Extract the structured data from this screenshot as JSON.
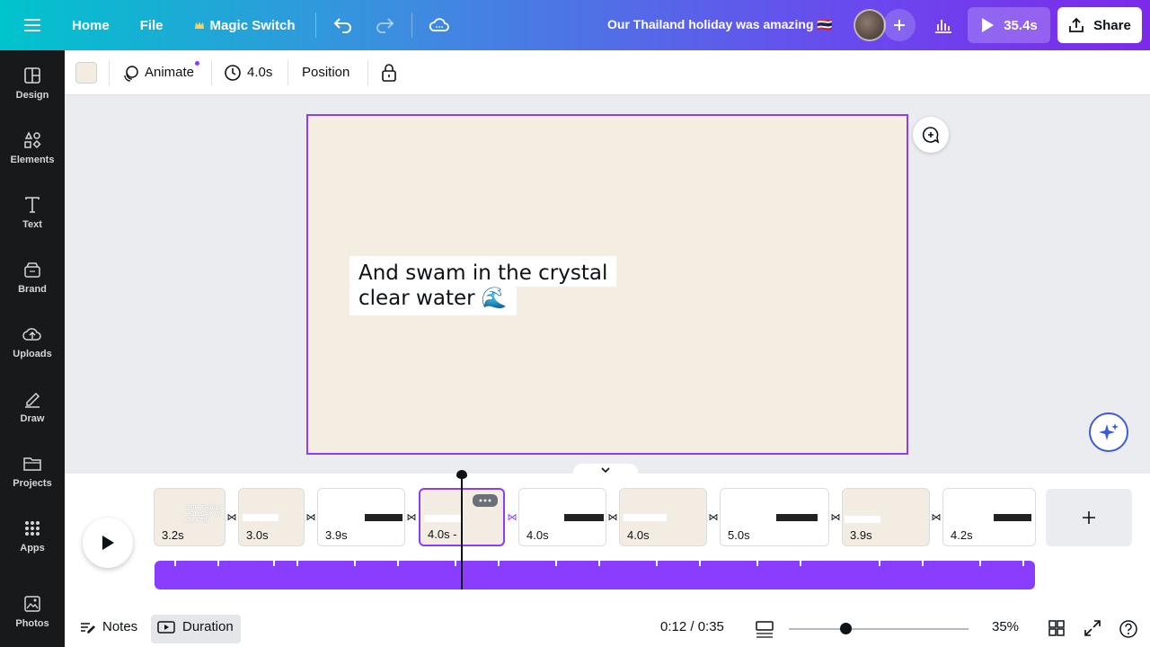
{
  "topbar": {
    "home": "Home",
    "file": "File",
    "magic_switch": "Magic Switch",
    "title": "Our Thailand holiday was amazing 🇹🇭",
    "play_duration": "35.4s",
    "share": "Share"
  },
  "sidebar": {
    "items": [
      {
        "label": "Design",
        "icon": "design-icon"
      },
      {
        "label": "Elements",
        "icon": "elements-icon"
      },
      {
        "label": "Text",
        "icon": "text-icon"
      },
      {
        "label": "Brand",
        "icon": "brand-icon"
      },
      {
        "label": "Uploads",
        "icon": "uploads-icon"
      },
      {
        "label": "Draw",
        "icon": "draw-icon"
      },
      {
        "label": "Projects",
        "icon": "projects-icon"
      },
      {
        "label": "Apps",
        "icon": "apps-icon"
      },
      {
        "label": "Photos",
        "icon": "photos-icon"
      }
    ]
  },
  "toolbar": {
    "background_color": "#f3ece1",
    "animate": "Animate",
    "duration": "4.0s",
    "position": "Position"
  },
  "canvas": {
    "background": "#f3ede2",
    "text_line1": "And swam in the crystal",
    "text_line2": "clear water 🌊"
  },
  "timeline": {
    "scenes": [
      {
        "duration": "3.2s",
        "bg": "#f2ece3"
      },
      {
        "duration": "3.0s",
        "bg": "#f2ece3"
      },
      {
        "duration": "3.9s",
        "bg": "#ffffff"
      },
      {
        "duration": "4.0s -",
        "bg": "#f2ece3",
        "active": true
      },
      {
        "duration": "4.0s",
        "bg": "#ffffff"
      },
      {
        "duration": "4.0s",
        "bg": "#f2ece3"
      },
      {
        "duration": "5.0s",
        "bg": "#ffffff"
      },
      {
        "duration": "3.9s",
        "bg": "#f2ece3"
      },
      {
        "duration": "4.2s",
        "bg": "#ffffff"
      }
    ],
    "playhead_fraction": 0.348
  },
  "bottom": {
    "notes": "Notes",
    "duration": "Duration",
    "time": "0:12 / 0:35",
    "zoom": "35%",
    "zoom_level": 0.35
  },
  "colors": {
    "accent": "#8b3dff",
    "sidebar": "#18191b"
  }
}
